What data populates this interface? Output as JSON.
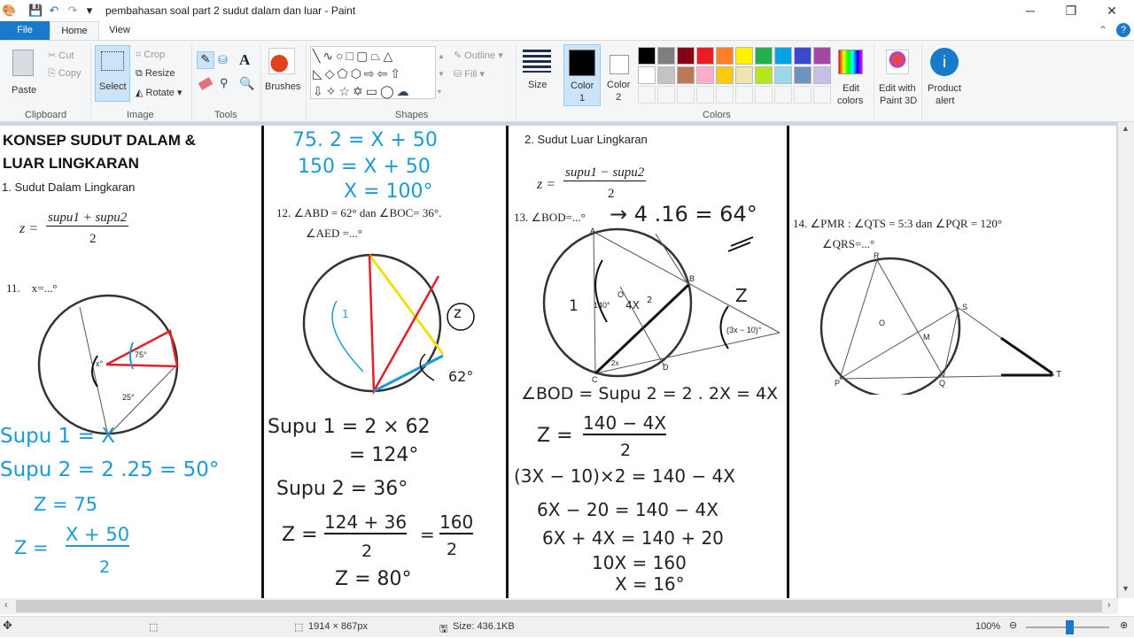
{
  "window": {
    "title": "pembahasan soal part 2 sudut dalam dan luar - Paint",
    "minimize": "─",
    "maximize": "❐",
    "close": "✕"
  },
  "tabs": [
    {
      "label": "File"
    },
    {
      "label": "Home"
    },
    {
      "label": "View"
    }
  ],
  "ribbon": {
    "clipboard": {
      "paste": "Paste",
      "cut": "Cut",
      "copy": "Copy",
      "group": "Clipboard"
    },
    "image": {
      "select": "Select",
      "crop": "Crop",
      "resize": "Resize",
      "rotate": "Rotate",
      "group": "Image"
    },
    "tools": {
      "group": "Tools"
    },
    "brushes": {
      "label": "Brushes"
    },
    "shapes": {
      "outline": "Outline",
      "fill": "Fill",
      "group": "Shapes"
    },
    "size": {
      "label": "Size"
    },
    "colors": {
      "color1": "Color",
      "color1_num": "1",
      "color2": "Color",
      "color2_num": "2",
      "edit": "Edit",
      "edit2": "colors",
      "group": "Colors",
      "palette_row1": [
        "#000000",
        "#7f7f7f",
        "#880015",
        "#ed1c24",
        "#ff7f27",
        "#fff200",
        "#22b14c",
        "#00a2e8",
        "#3f48cc",
        "#a349a4"
      ],
      "palette_row2": [
        "#ffffff",
        "#c3c3c3",
        "#b97a57",
        "#ffaec9",
        "#ffc90e",
        "#efe4b0",
        "#b5e61d",
        "#99d9ea",
        "#7092be",
        "#c8bfe7"
      ]
    },
    "paint3d": {
      "l1": "Edit with",
      "l2": "Paint 3D"
    },
    "alert": {
      "l1": "Product",
      "l2": "alert"
    }
  },
  "canvas": {
    "col1": {
      "title1": "KONSEP SUDUT DALAM &",
      "title2": "LUAR LINGKARAN",
      "sub": "1. Sudut Dalam Lingkaran",
      "formula_lhs": "z =",
      "formula_num": "supu1 + supu2",
      "formula_den": "2",
      "q11": "11.    x=...°",
      "hw": [
        "Supu 1 = X",
        "Supu  2 = 2 .25 = 50°",
        "Z = 75",
        "Z  =",
        "X  + 50",
        "2"
      ],
      "fig": [
        "x°",
        "75°",
        "25°"
      ]
    },
    "col2": {
      "hw_top": [
        "75. 2 = X + 50",
        "150 = X + 50",
        "X = 100°"
      ],
      "q12a": "12.   ∠ABD = 62° dan ∠BOC= 36°.",
      "q12b": "∠AED =...°",
      "hw": [
        "Supu 1  =  2 × 62",
        "= 124°",
        "Supu 2 = 36°",
        "Z =",
        "124 + 36",
        "2",
        "=",
        "160",
        "2",
        "Z = 80°"
      ],
      "fig": [
        "z",
        "62°",
        "1"
      ]
    },
    "col3": {
      "sub": "2. Sudut Luar Lingkaran",
      "formula_lhs": "z =",
      "formula_num": "supu1 − supu2",
      "formula_den": "2",
      "q13": "13.   ∠BOD=...°",
      "hw_ans": "→ 4 .16 = 64°",
      "hw": [
        "∠BOD = Supu 2 = 2 . 2X = 4X",
        "Z =",
        "140 − 4X",
        "2",
        "(3X − 10)×2  = 140 − 4X",
        "6X − 20 = 140 − 4X",
        "6X + 4X = 140 + 20",
        "10X = 160",
        "X = 16°"
      ],
      "fig": [
        "A",
        "B",
        "C",
        "D",
        "O",
        "140°",
        "4X",
        "2",
        "2x",
        "(3x − 10)°",
        "Z",
        "1"
      ]
    },
    "col4": {
      "q14a": "14.   ∠PMR : ∠QTS = 5:3 dan ∠PQR = 120°",
      "q14b": "∠QRS=...°",
      "fig": [
        "R",
        "S",
        "M",
        "O",
        "P",
        "Q",
        "T"
      ]
    }
  },
  "status": {
    "dimensions": "1914 × 867px",
    "size": "Size: 436.1KB",
    "zoom": "100%"
  }
}
